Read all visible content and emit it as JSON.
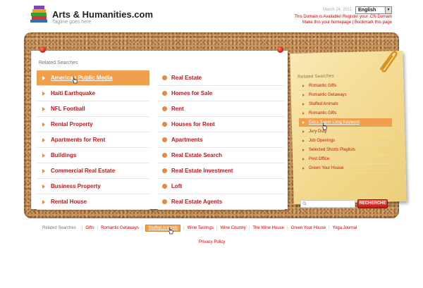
{
  "header": {
    "title": "Arts & Humanities.com",
    "tagline": "Tagline goes here",
    "date": "March 24, 2011",
    "language": "English",
    "domain_available": "This Domain is Available!  Register your .CN Domain",
    "homepage_links": "Make this your homepage | Bookmark this page"
  },
  "left_panel": {
    "label": "Related Searches",
    "column1": [
      "American Public Media",
      "Haiti Earthquake",
      "NFL Football",
      "Rental Property",
      "Apartments for Rent",
      "Buildings",
      "Commercial Real Estate",
      "Business Property",
      "Rental House"
    ],
    "column2": [
      "Real Estate",
      "Homes for Sale",
      "Rent",
      "Houses for Rent",
      "Apartments",
      "Real Estate Search",
      "Real Estate Investment",
      "Loft",
      "Real Estate Agents"
    ]
  },
  "right_panel": {
    "label": "Related Searches",
    "items": [
      "Romantic Gifts",
      "Romantic Getaways",
      "Stuffed Animals",
      "Romantic Gifts",
      "Extra Super Long Keyword",
      "Jury Duty",
      "Job Openings",
      "Selected Shorts Playlists",
      "Post Office",
      "Green Your House"
    ],
    "search_button": "RECHERCHE"
  },
  "bottom": {
    "label": "Related Searches",
    "links": [
      "Gifts",
      "Romantic Getaways",
      "Stuffed Animals",
      "Wine Tastings",
      "Wine Country",
      "The Wine House",
      "Green Your House",
      "Yoga Journal"
    ],
    "privacy": "Privacy Policy"
  },
  "colors": {
    "accent": "#f0a04c",
    "link": "#c0181c",
    "cork": "#c9955e",
    "note": "#f3d98e"
  }
}
